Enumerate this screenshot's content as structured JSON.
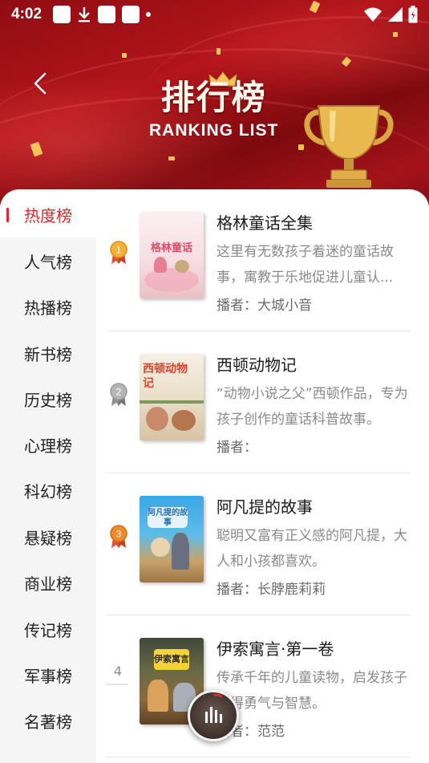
{
  "status_bar": {
    "time": "4:02",
    "icons": [
      "notification-square-icon",
      "download-icon",
      "notification-square-icon",
      "notification-square-icon",
      "dot-icon",
      "wifi-icon",
      "signal-icon",
      "battery-icon"
    ]
  },
  "header": {
    "title_cn": "排行榜",
    "title_en": "RANKING LIST",
    "back_icon": "chevron-left-icon",
    "background_color": "#a5131a",
    "accent_gold": "#f3c45a"
  },
  "sidebar": {
    "active_color": "#e0282e",
    "items": [
      {
        "label": "热度榜",
        "active": true
      },
      {
        "label": "人气榜",
        "active": false
      },
      {
        "label": "热播榜",
        "active": false
      },
      {
        "label": "新书榜",
        "active": false
      },
      {
        "label": "历史榜",
        "active": false
      },
      {
        "label": "心理榜",
        "active": false
      },
      {
        "label": "科幻榜",
        "active": false
      },
      {
        "label": "悬疑榜",
        "active": false
      },
      {
        "label": "商业榜",
        "active": false
      },
      {
        "label": "传记榜",
        "active": false
      },
      {
        "label": "军事榜",
        "active": false
      },
      {
        "label": "名著榜",
        "active": false
      }
    ]
  },
  "books": [
    {
      "rank": "1",
      "rank_badge": "gold-medal-icon",
      "title": "格林童话全集",
      "description": "这里有无数孩子着迷的童话故事，寓教于乐地促进儿童认...",
      "author": "播者：大城小音",
      "cover_text": "格林童话"
    },
    {
      "rank": "2",
      "rank_badge": "silver-medal-icon",
      "title": "西顿动物记",
      "description": "“动物小说之父”西顿作品，专为孩子创作的童话科普故事。",
      "author": "播者：",
      "cover_text": "西顿动物记"
    },
    {
      "rank": "3",
      "rank_badge": "bronze-medal-icon",
      "title": "阿凡提的故事",
      "description": "聪明又富有正义感的阿凡提，大人和小孩都喜欢。",
      "author": "播者：长脖鹿莉莉",
      "cover_text": "阿凡提的故事"
    },
    {
      "rank": "4",
      "rank_badge": "",
      "title": "伊索寓言·第一卷",
      "description": "传承千年的儿童读物，启发孩子获得勇气与智慧。",
      "author": "播者：范范",
      "cover_text": "伊索寓言"
    }
  ],
  "player": {
    "icon": "audio-bars-icon"
  }
}
